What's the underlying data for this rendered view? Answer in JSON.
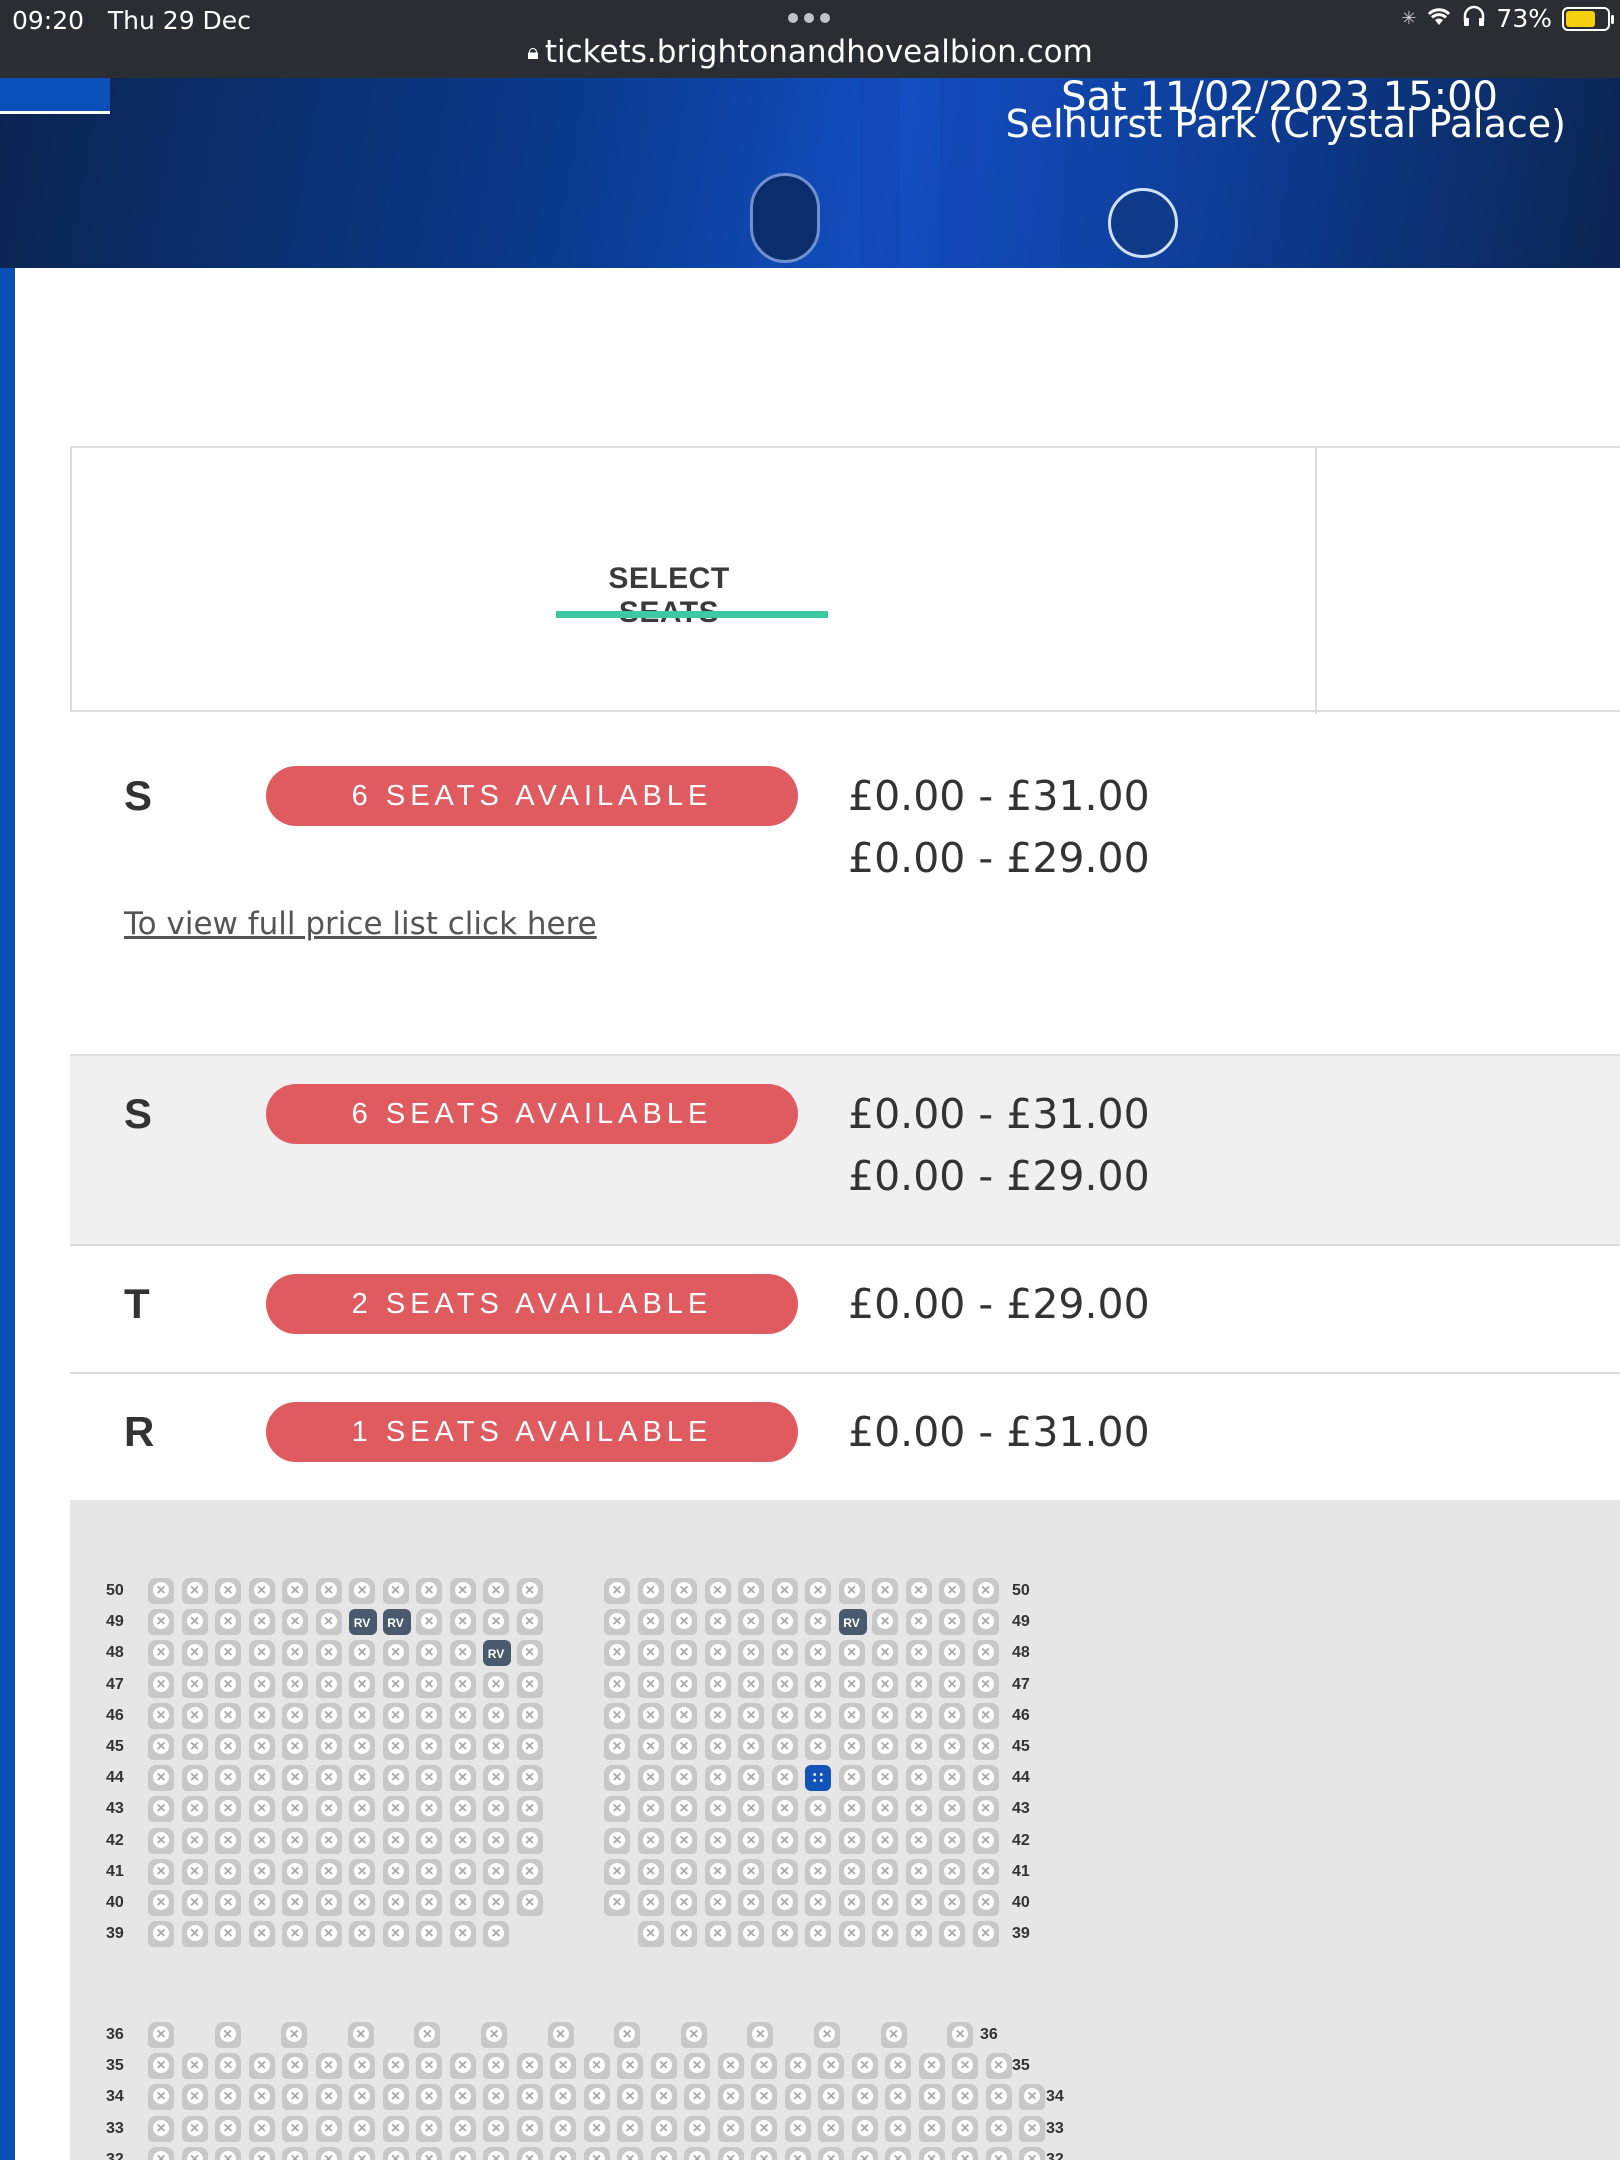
{
  "status_bar": {
    "time": "09:20",
    "date": "Thu 29 Dec",
    "battery": "73%",
    "url": "tickets.brightonandhovealbion.com"
  },
  "hero": {
    "datetime": "Sat 11/02/2023 15:00",
    "venue": "Selhurst Park (Crystal Palace)"
  },
  "tabs": {
    "active": "SELECT SEATS"
  },
  "rows": [
    {
      "letter": "S",
      "availability": "6 SEATS AVAILABLE",
      "prices": [
        "£0.00 - £31.00",
        "£0.00 - £29.00"
      ],
      "link": "To view full price list click here"
    },
    {
      "letter": "S",
      "availability": "6 SEATS AVAILABLE",
      "prices": [
        "£0.00 - £31.00",
        "£0.00 - £29.00"
      ]
    },
    {
      "letter": "T",
      "availability": "2 SEATS AVAILABLE",
      "prices": [
        "£0.00 - £29.00"
      ]
    },
    {
      "letter": "R",
      "availability": "1 SEATS AVAILABLE",
      "prices": [
        "£0.00 - £31.00"
      ]
    }
  ],
  "seat_map": {
    "upper_rows": [
      "50",
      "49",
      "48",
      "47",
      "46",
      "45",
      "44",
      "43",
      "42",
      "41",
      "40",
      "39"
    ],
    "lower_rows": [
      "36",
      "35",
      "34",
      "33",
      "32"
    ],
    "legend": {
      "rv": "RV"
    },
    "colors": {
      "unavailable": "#c8c8c8",
      "reserved": "#4a5a6e",
      "available": "#1153b8",
      "pill": "#e05b60",
      "tab_accent": "#3ecaa0"
    }
  }
}
